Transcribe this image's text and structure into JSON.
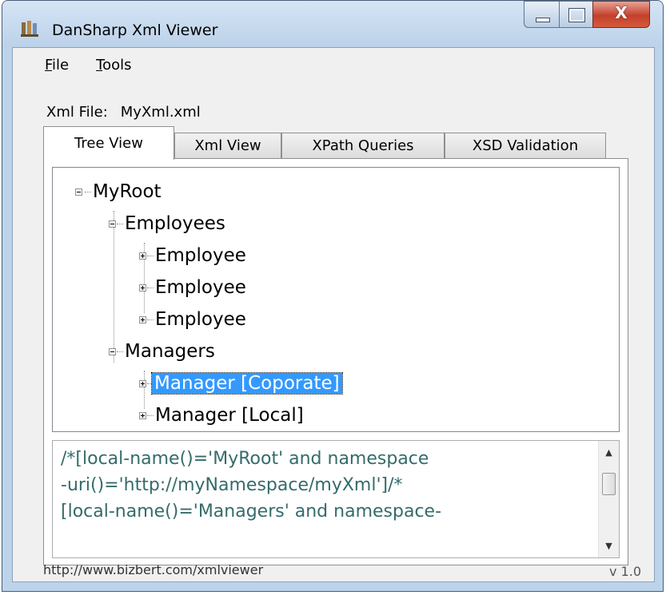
{
  "window": {
    "title": "DanSharp Xml Viewer",
    "icon": "app-icon",
    "controls": {
      "minimize": "minimize-icon",
      "maximize": "maximize-icon",
      "close_glyph": "X"
    }
  },
  "menu": {
    "file": "F",
    "file_rest": "ile",
    "tools": "T",
    "tools_rest": "ools"
  },
  "file_row": {
    "label": "Xml File:",
    "value": "MyXml.xml"
  },
  "tabs": [
    {
      "label": "Tree View",
      "active": true
    },
    {
      "label": "Xml View"
    },
    {
      "label": "XPath Queries"
    },
    {
      "label": "XSD Validation"
    }
  ],
  "tree": {
    "root": "MyRoot",
    "employees": "Employees",
    "employee_1": "Employee",
    "employee_2": "Employee",
    "employee_3": "Employee",
    "managers": "Managers",
    "manager_corporate": "Manager [Coporate]",
    "manager_local": "Manager [Local]"
  },
  "xpath": {
    "lines": [
      "/*[local-name()='MyRoot' and namespace",
      "-uri()='http://myNamespace/myXml']/*",
      "[local-name()='Managers' and namespace-"
    ]
  },
  "status": {
    "url": "http://www.bizbert.com/xmlviewer",
    "version": "v 1.0"
  },
  "colors": {
    "selection": "#3399ff",
    "xpath_text": "#356b6b",
    "close_button": "#c4402c"
  }
}
